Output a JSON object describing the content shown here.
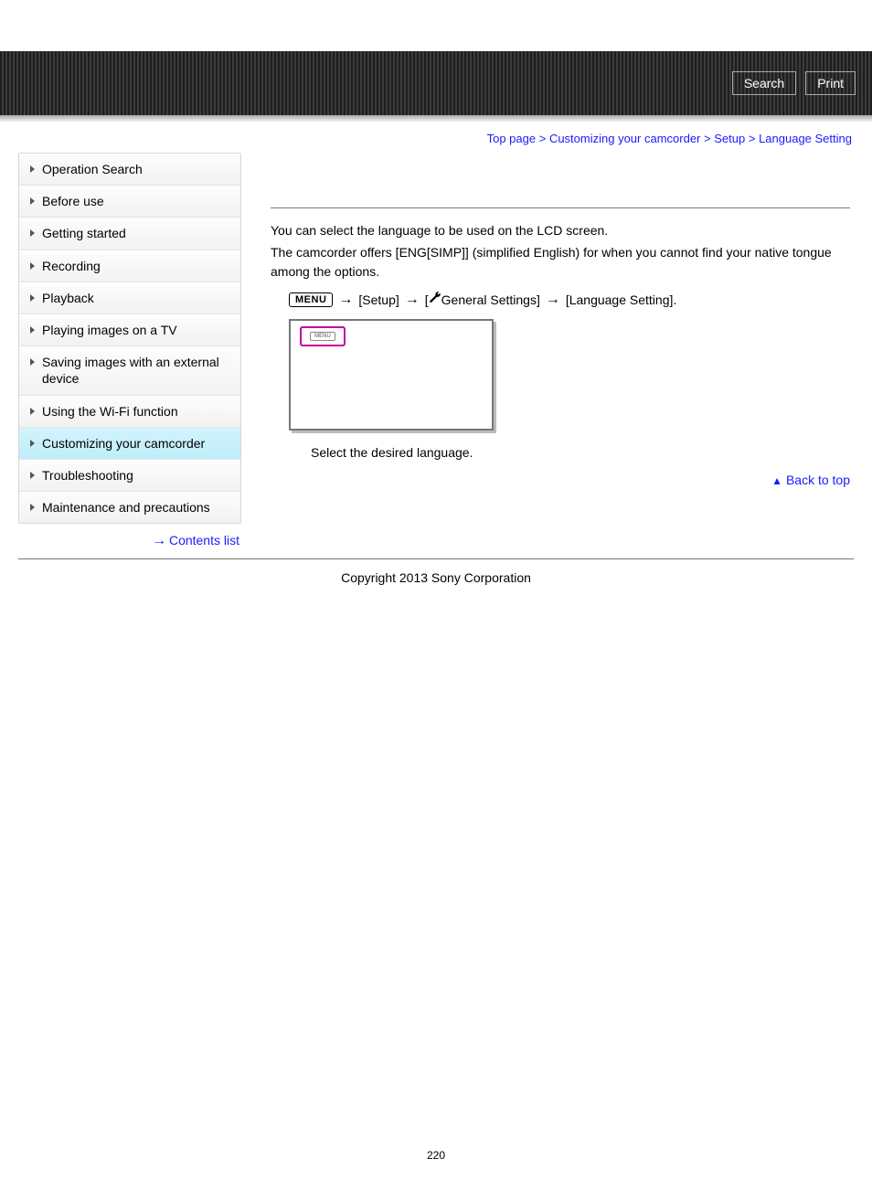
{
  "header": {
    "search_label": "Search",
    "print_label": "Print"
  },
  "breadcrumb": {
    "items": [
      "Top page",
      "Customizing your camcorder",
      "Setup"
    ],
    "current": "Language Setting",
    "sep": ">"
  },
  "sidebar": {
    "items": [
      {
        "label": "Operation Search"
      },
      {
        "label": "Before use"
      },
      {
        "label": "Getting started"
      },
      {
        "label": "Recording"
      },
      {
        "label": "Playback"
      },
      {
        "label": "Playing images on a TV"
      },
      {
        "label": "Saving images with an external device"
      },
      {
        "label": "Using the Wi-Fi function"
      },
      {
        "label": "Customizing your camcorder"
      },
      {
        "label": "Troubleshooting"
      },
      {
        "label": "Maintenance and precautions"
      }
    ],
    "active_index": 8,
    "contents_list_label": "Contents list"
  },
  "content": {
    "intro_line1": "You can select the language to be used on the LCD screen.",
    "intro_line2": "The camcorder offers [ENG[SIMP]] (simplified English) for when you cannot find your native tongue among the options.",
    "menu_box": "MENU",
    "nav_setup": "[Setup]",
    "nav_general_open": "[",
    "nav_general_text": "General Settings]",
    "nav_lang": "[Language Setting].",
    "mini_label": "MENU",
    "step_text": "Select the desired language.",
    "back_to_top": "Back to top"
  },
  "footer": {
    "copyright": "Copyright 2013 Sony Corporation",
    "page_number": "220"
  }
}
